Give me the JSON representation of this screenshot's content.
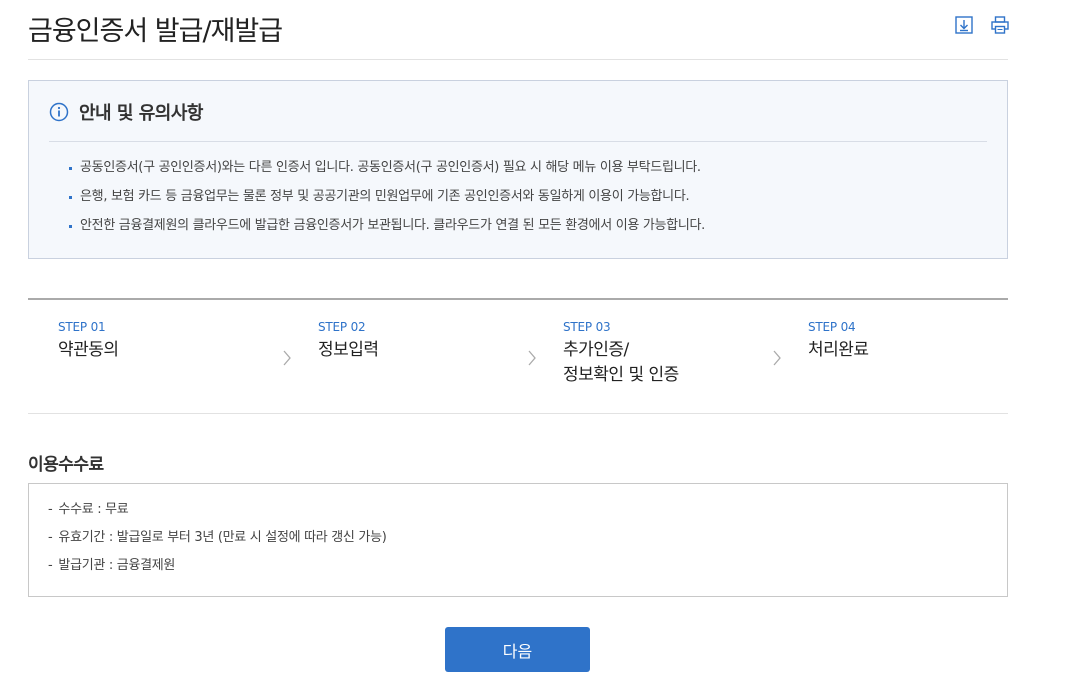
{
  "page": {
    "title": "금융인증서 발급/재발급"
  },
  "toolbar": {
    "download_icon": "download-icon",
    "print_icon": "print-icon"
  },
  "notice": {
    "title": "안내 및 유의사항",
    "icon": "info-icon",
    "items": [
      "공동인증서(구 공인인증서)와는 다른 인증서 입니다. 공동인증서(구 공인인증서) 필요 시 해당 메뉴 이용 부탁드립니다.",
      "은행, 보험 카드 등 금융업무는 물론 정부 및 공공기관의 민원업무에 기존 공인인증서와 동일하게 이용이 가능합니다.",
      "안전한 금융결제원의 클라우드에 발급한 금융인증서가 보관됩니다. 클라우드가 연결 된 모든 환경에서 이용 가능합니다."
    ]
  },
  "steps": [
    {
      "num": "STEP 01",
      "label": "약관동의"
    },
    {
      "num": "STEP 02",
      "label": "정보입력"
    },
    {
      "num": "STEP 03",
      "label": "추가인증/\n정보확인 및 인증"
    },
    {
      "num": "STEP 04",
      "label": "처리완료"
    }
  ],
  "fee": {
    "title": "이용수수료",
    "items": [
      "수수료 : 무료",
      "유효기간 : 발급일로 부터 3년 (만료 시 설정에 따라 갱신 가능)",
      "발급기관 : 금융결제원"
    ]
  },
  "actions": {
    "next_label": "다음"
  },
  "colors": {
    "accent": "#2f73c9",
    "notice_bg": "#f5f8fc"
  }
}
